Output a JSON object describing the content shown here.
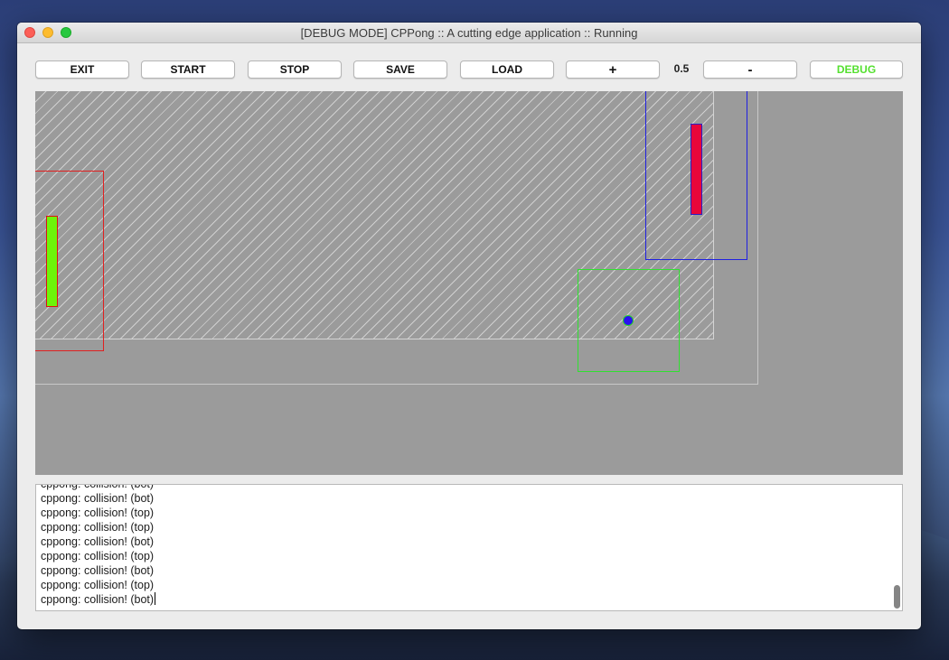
{
  "window": {
    "title": "[DEBUG MODE] CPPong :: A cutting edge application :: Running",
    "controls": [
      "close",
      "minimize",
      "zoom"
    ]
  },
  "toolbar": {
    "exit": "EXIT",
    "start": "START",
    "stop": "STOP",
    "save": "SAVE",
    "load": "LOAD",
    "plus": "+",
    "speed": "0.5",
    "minus": "-",
    "debug": "DEBUG"
  },
  "colors": {
    "debug_label": "#55e030",
    "left_paddle": "#6df40a",
    "right_paddle": "#e8063a",
    "ball": "#2a10f0",
    "left_hitbox": "#e02020",
    "right_hitbox": "#2020e0",
    "ball_hitbox": "#30e030",
    "canvas_bg": "#9b9b9b"
  },
  "log": {
    "lines": [
      "cppong: collision! (bot)",
      "cppong: collision! (bot)",
      "cppong: collision! (top)",
      "cppong: collision! (top)",
      "cppong: collision! (bot)",
      "cppong: collision! (top)",
      "cppong: collision! (bot)",
      "cppong: collision! (top)",
      "cppong: collision! (bot)"
    ]
  }
}
